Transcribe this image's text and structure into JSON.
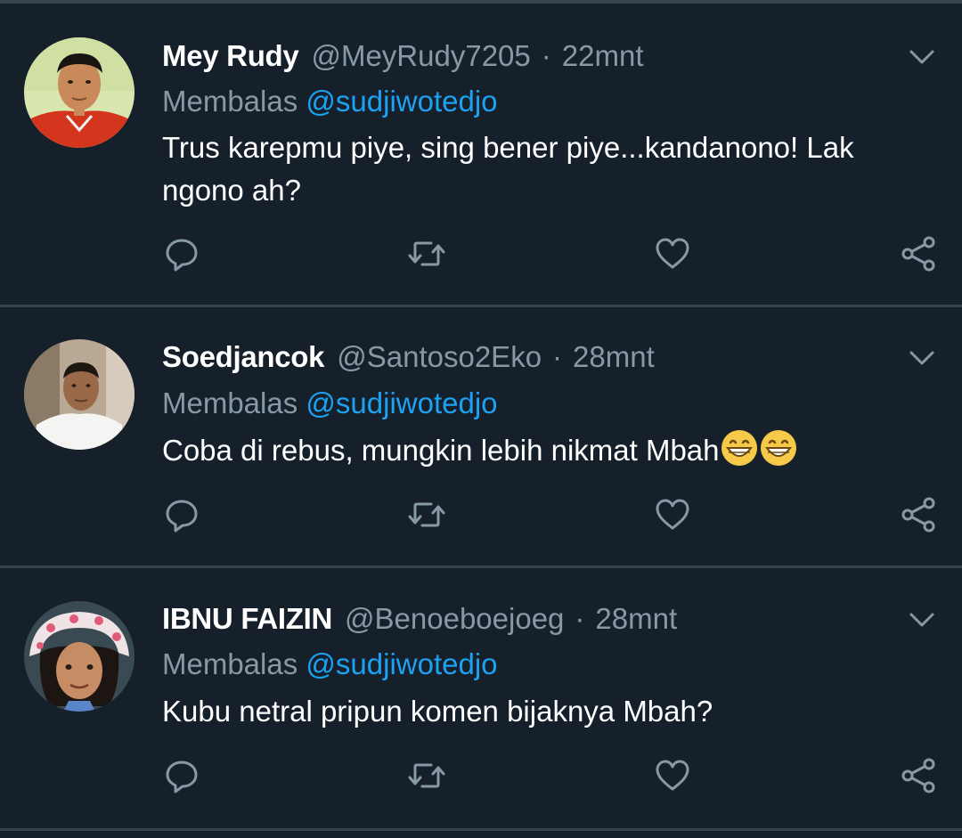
{
  "tweets": [
    {
      "display_name": "Mey Rudy",
      "handle": "@MeyRudy7205",
      "separator": "·",
      "time": "22mnt",
      "reply_prefix": "Membalas",
      "reply_to": "@sudjiwotedjo",
      "text": "Trus karepmu piye, sing bener piye...kandanono! Lak ngono ah?",
      "avatar": "avatar-photo-man-red-shirt",
      "emojis": []
    },
    {
      "display_name": "Soedjancok",
      "handle": "@Santoso2Eko",
      "separator": "·",
      "time": "28mnt",
      "reply_prefix": "Membalas",
      "reply_to": "@sudjiwotedjo",
      "text": "Coba di rebus, mungkin lebih nikmat Mbah",
      "avatar": "avatar-photo-man-white-shirt",
      "emojis": [
        "grinning-face-emoji",
        "grinning-face-emoji"
      ]
    },
    {
      "display_name": "IBNU FAIZIN",
      "handle": "@Benoeboejoeg",
      "separator": "·",
      "time": "28mnt",
      "reply_prefix": "Membalas",
      "reply_to": "@sudjiwotedjo",
      "text": "Kubu netral pripun komen bijaknya Mbah?",
      "avatar": "avatar-photo-child-hat",
      "emojis": []
    }
  ],
  "actions": [
    "reply-icon",
    "retweet-icon",
    "like-icon",
    "share-icon"
  ],
  "colors": {
    "background": "#15202b",
    "divider": "#38444d",
    "secondary_text": "#8899a6",
    "mention": "#1da1f2",
    "primary_text": "#ffffff"
  }
}
